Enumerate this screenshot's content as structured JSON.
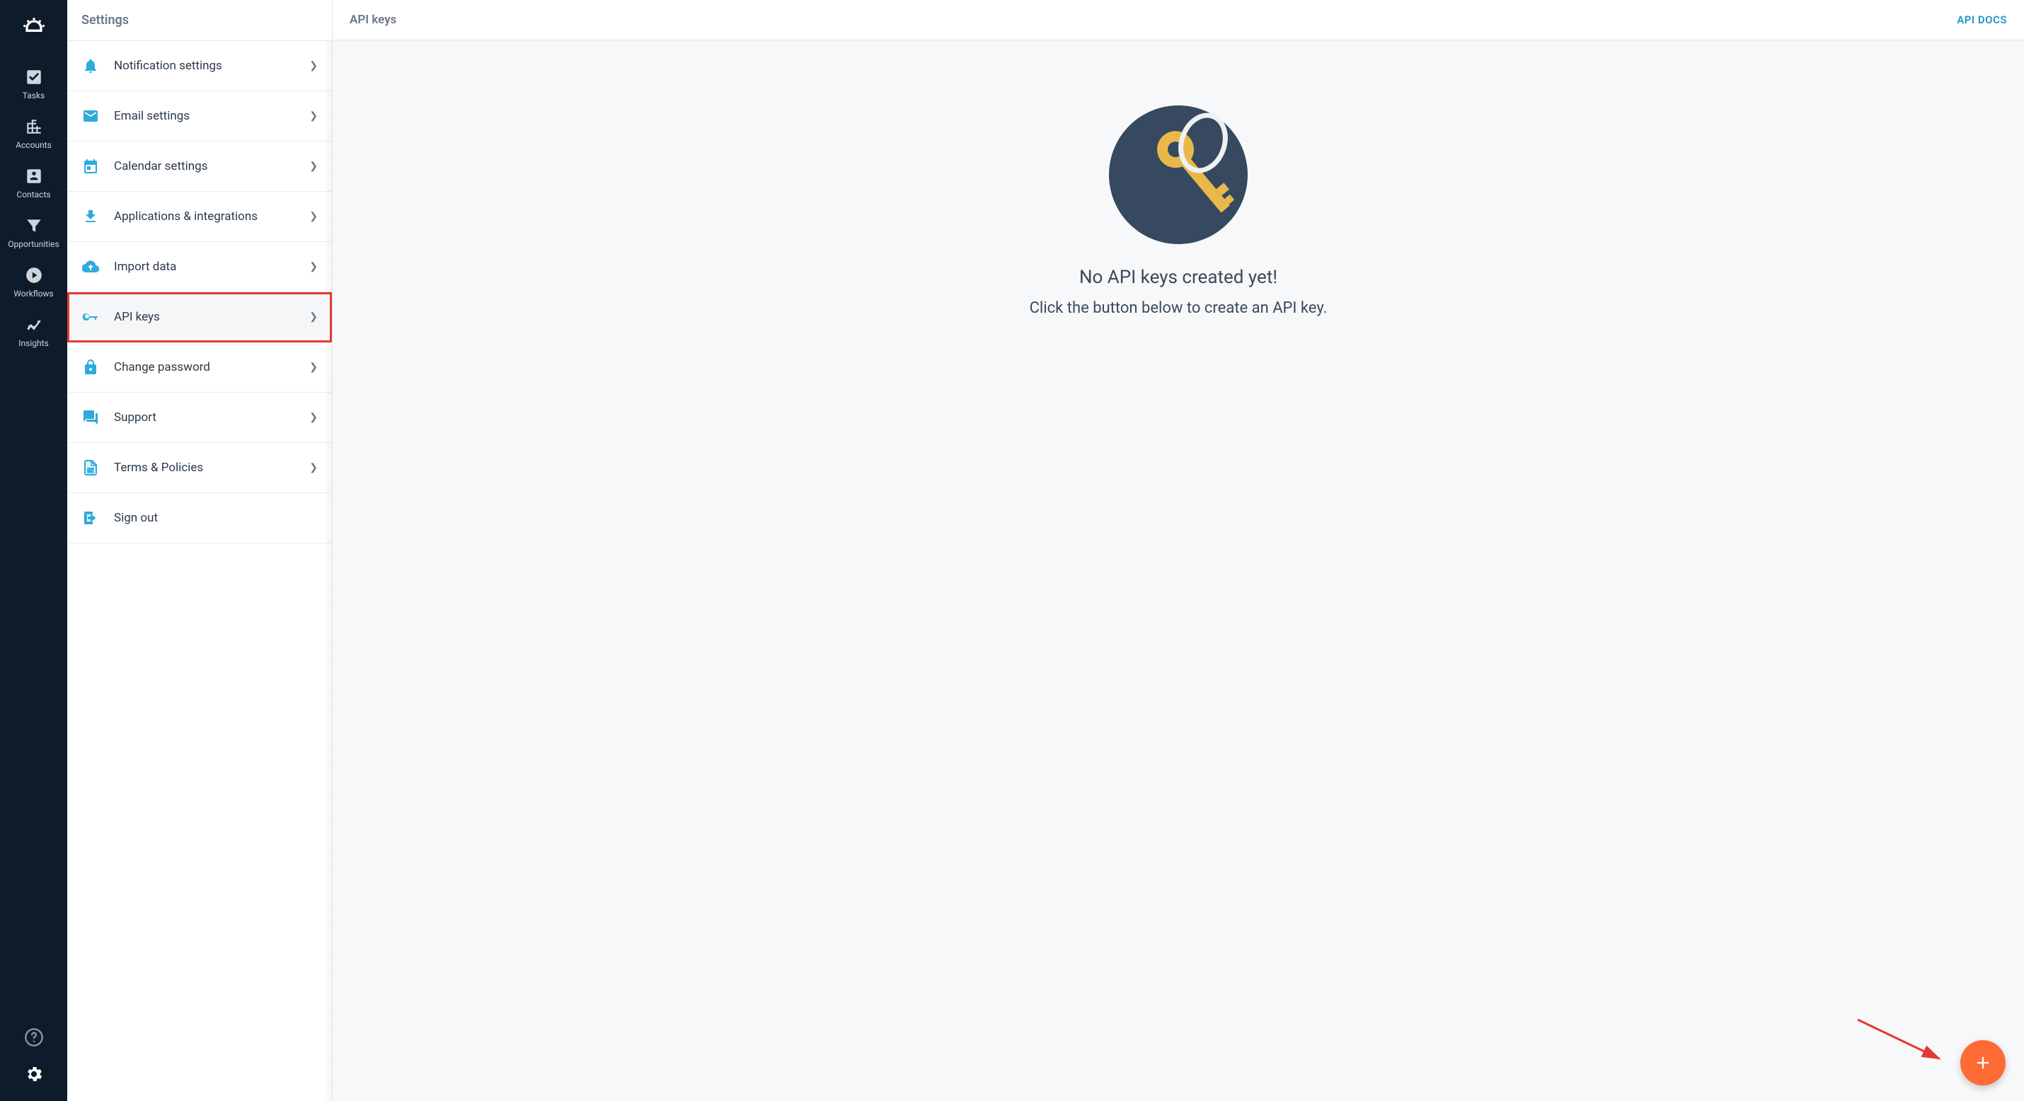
{
  "nav": {
    "items": [
      {
        "label": "Tasks"
      },
      {
        "label": "Accounts"
      },
      {
        "label": "Contacts"
      },
      {
        "label": "Opportunities"
      },
      {
        "label": "Workflows"
      },
      {
        "label": "Insights"
      }
    ]
  },
  "settings": {
    "header": "Settings",
    "items": [
      {
        "label": "Notification settings"
      },
      {
        "label": "Email settings"
      },
      {
        "label": "Calendar settings"
      },
      {
        "label": "Applications & integrations"
      },
      {
        "label": "Import data"
      },
      {
        "label": "API keys"
      },
      {
        "label": "Change password"
      },
      {
        "label": "Support"
      },
      {
        "label": "Terms & Policies"
      },
      {
        "label": "Sign out"
      }
    ]
  },
  "main": {
    "title": "API keys",
    "docs_link": "API DOCS",
    "empty_title": "No API keys created yet!",
    "empty_sub": "Click the button below to create an API key."
  }
}
